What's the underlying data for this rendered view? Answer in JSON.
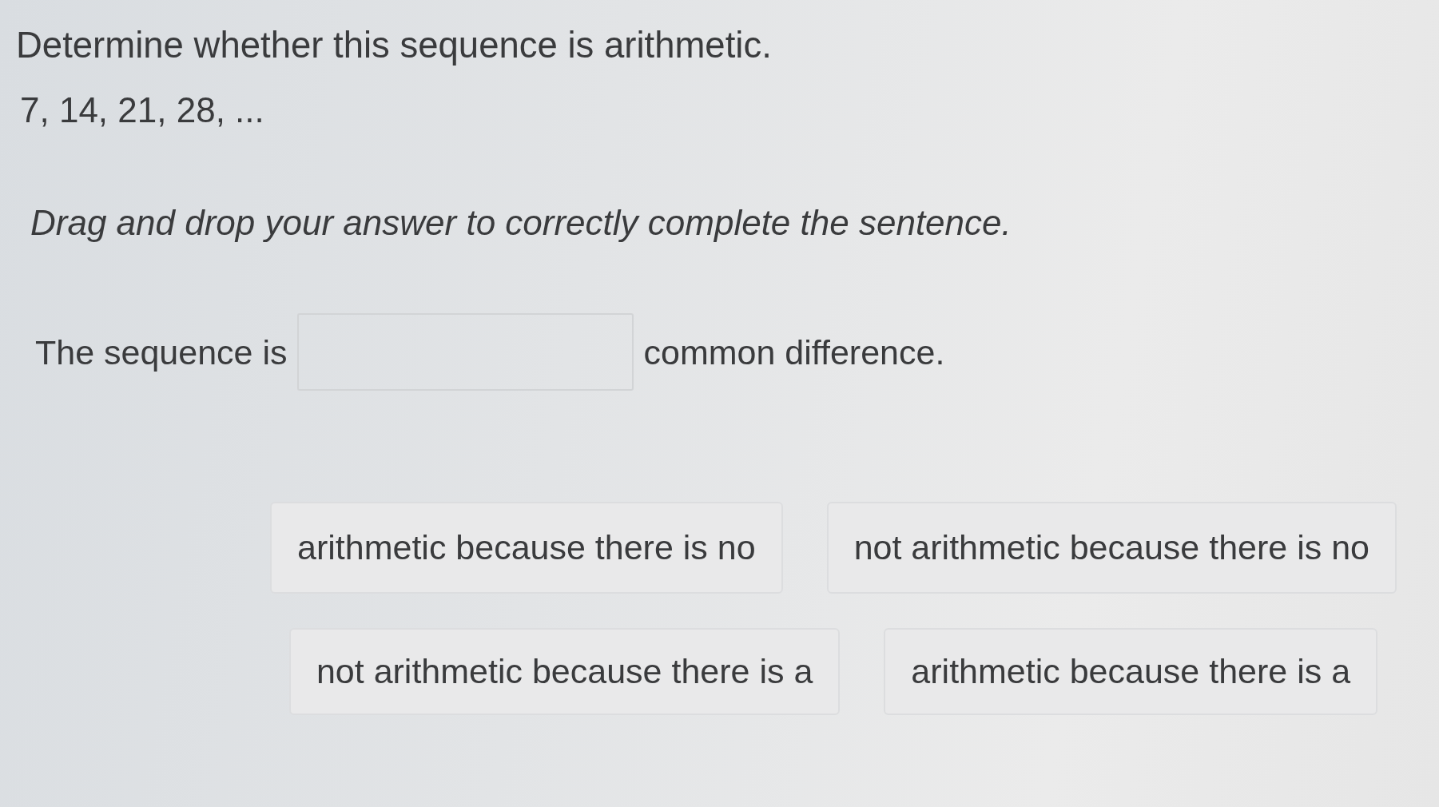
{
  "question": "Determine whether this sequence is arithmetic.",
  "sequence": "7, 14, 21, 28, ...",
  "instruction": "Drag and drop your answer to correctly complete the sentence.",
  "sentence": {
    "before": "The sequence is",
    "after": "common difference."
  },
  "answer_rows": [
    [
      "arithmetic because there is no",
      "not arithmetic because there is no"
    ],
    [
      "not arithmetic because there is a",
      "arithmetic because there is a"
    ]
  ]
}
